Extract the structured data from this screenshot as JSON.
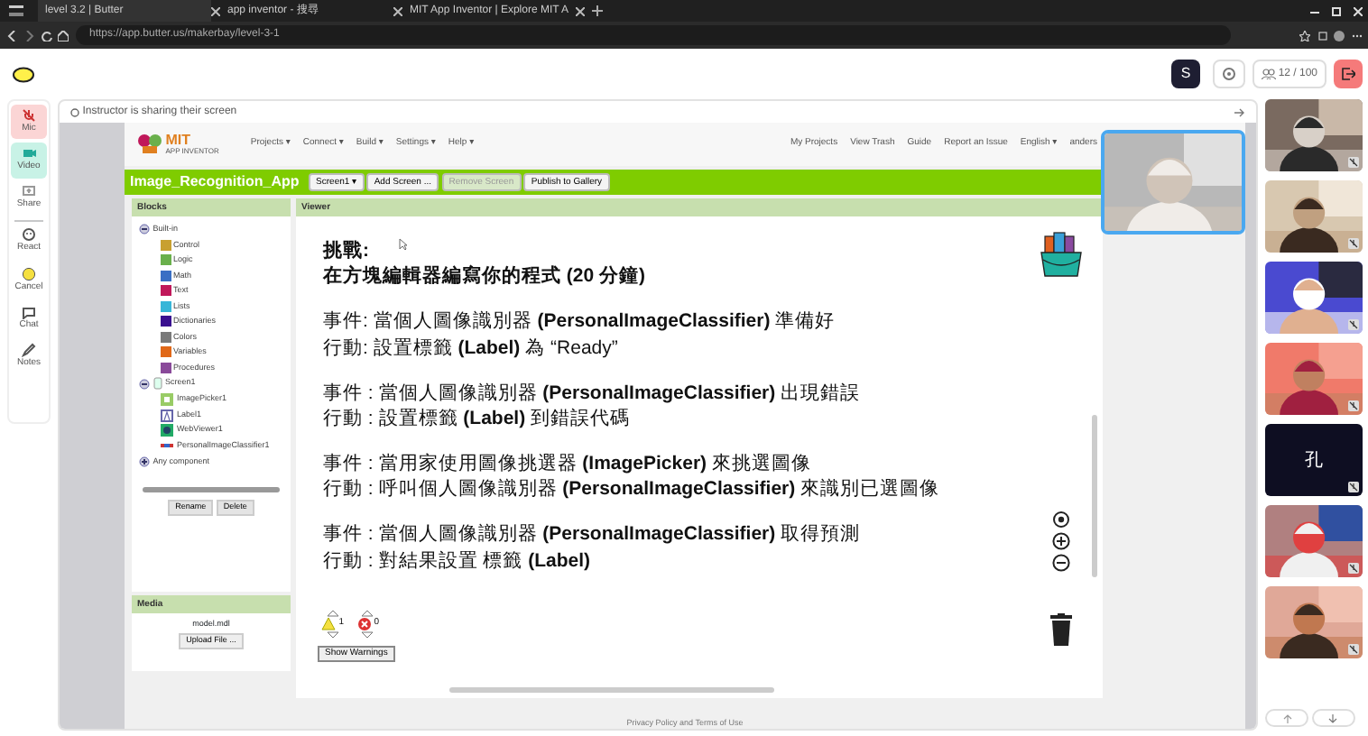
{
  "browser": {
    "tabs": [
      {
        "title": "level 3.2 | Butter",
        "selected": true
      },
      {
        "title": "app inventor - 搜尋",
        "selected": false
      },
      {
        "title": "MIT App Inventor | Explore MIT A",
        "selected": false
      }
    ],
    "url": "https://app.butter.us/makerbay/level-3-1"
  },
  "header": {
    "user_initial": "S",
    "participants": "12 / 100"
  },
  "rail": [
    {
      "label": "Mic",
      "kind": "mic",
      "on": false
    },
    {
      "label": "Video",
      "kind": "video",
      "on": true
    },
    {
      "label": "Share",
      "kind": "share",
      "on": false
    },
    {
      "label": "React",
      "kind": "react",
      "on": false
    },
    {
      "label": "Cancel",
      "kind": "cancel",
      "on": false
    },
    {
      "label": "Chat",
      "kind": "chat",
      "on": false
    },
    {
      "label": "Notes",
      "kind": "notes",
      "on": false
    }
  ],
  "share_banner": "Instructor is sharing their screen",
  "app_inventor": {
    "logo_title": "MIT",
    "logo_subtitle": "APP INVENTOR",
    "menus": [
      "Projects ▾",
      "Connect ▾",
      "Build ▾",
      "Settings ▾",
      "Help ▾"
    ],
    "right_menus": [
      "My Projects",
      "View Trash",
      "Guide",
      "Report an Issue",
      "English ▾",
      "anders"
    ],
    "project": "Image_Recognition_App",
    "project_buttons": [
      {
        "label": "Screen1 ▾",
        "disabled": false
      },
      {
        "label": "Add Screen ...",
        "disabled": false
      },
      {
        "label": "Remove Screen",
        "disabled": true
      },
      {
        "label": "Publish to Gallery",
        "disabled": false
      }
    ],
    "blocks_title": "Blocks",
    "tree": [
      {
        "label": "Built-in",
        "kind": "group",
        "children": [
          {
            "label": "Control",
            "color": "#c8a030"
          },
          {
            "label": "Logic",
            "color": "#6ab04c"
          },
          {
            "label": "Math",
            "color": "#3a6fc4"
          },
          {
            "label": "Text",
            "color": "#c0185a"
          },
          {
            "label": "Lists",
            "color": "#38b6d8"
          },
          {
            "label": "Dictionaries",
            "color": "#3a1090"
          },
          {
            "label": "Colors",
            "color": "#7a7a7a"
          },
          {
            "label": "Variables",
            "color": "#e06818"
          },
          {
            "label": "Procedures",
            "color": "#8a4a9a"
          }
        ]
      },
      {
        "label": "Screen1",
        "kind": "screen",
        "children": [
          {
            "label": "ImagePicker1",
            "kind": "imagepicker"
          },
          {
            "label": "Label1",
            "kind": "label"
          },
          {
            "label": "WebViewer1",
            "kind": "webviewer"
          },
          {
            "label": "PersonalImageClassifier1",
            "kind": "classifier"
          }
        ]
      },
      {
        "label": "Any component",
        "kind": "any"
      }
    ],
    "tree_buttons": [
      "Rename",
      "Delete"
    ],
    "media_title": "Media",
    "media_file": "model.mdl",
    "upload_button": "Upload File ...",
    "viewer_title": "Viewer",
    "instructions": [
      [
        "挑戰:",
        "在方塊編輯器編寫你的程式 (20 分鐘)"
      ],
      [
        "事件: 當個人圖像識別器 **(PersonalImageClassifier)** 準備好",
        "行動: 設置標籤 **(Label)** 為 “Ready”"
      ],
      [
        "事件 : 當個人圖像識別器 **(PersonalImageClassifier)** 出現錯誤",
        "行動 : 設置標籤 **(Label)** 到錯誤代碼"
      ],
      [
        "事件 : 當用家使用圖像挑選器 **(ImagePicker)** 來挑選圖像",
        "行動 : 呼叫個人圖像識別器 **(PersonalImageClassifier)** 來識別已選圖像"
      ],
      [
        "事件 : 當個人圖像識別器 **(PersonalImageClassifier)** 取得預測",
        "行動 : 對結果設置 標籤 **(Label)**"
      ]
    ],
    "warnings": "1",
    "errors": "0",
    "show_warnings": "Show Warnings",
    "footer": "Privacy Policy and Terms of Use"
  },
  "participants": [
    {
      "kind": "picture"
    },
    {
      "kind": "picture"
    },
    {
      "kind": "picture"
    },
    {
      "kind": "picture"
    },
    {
      "kind": "initial",
      "initial": "孔"
    },
    {
      "kind": "picture"
    },
    {
      "kind": "picture"
    }
  ]
}
